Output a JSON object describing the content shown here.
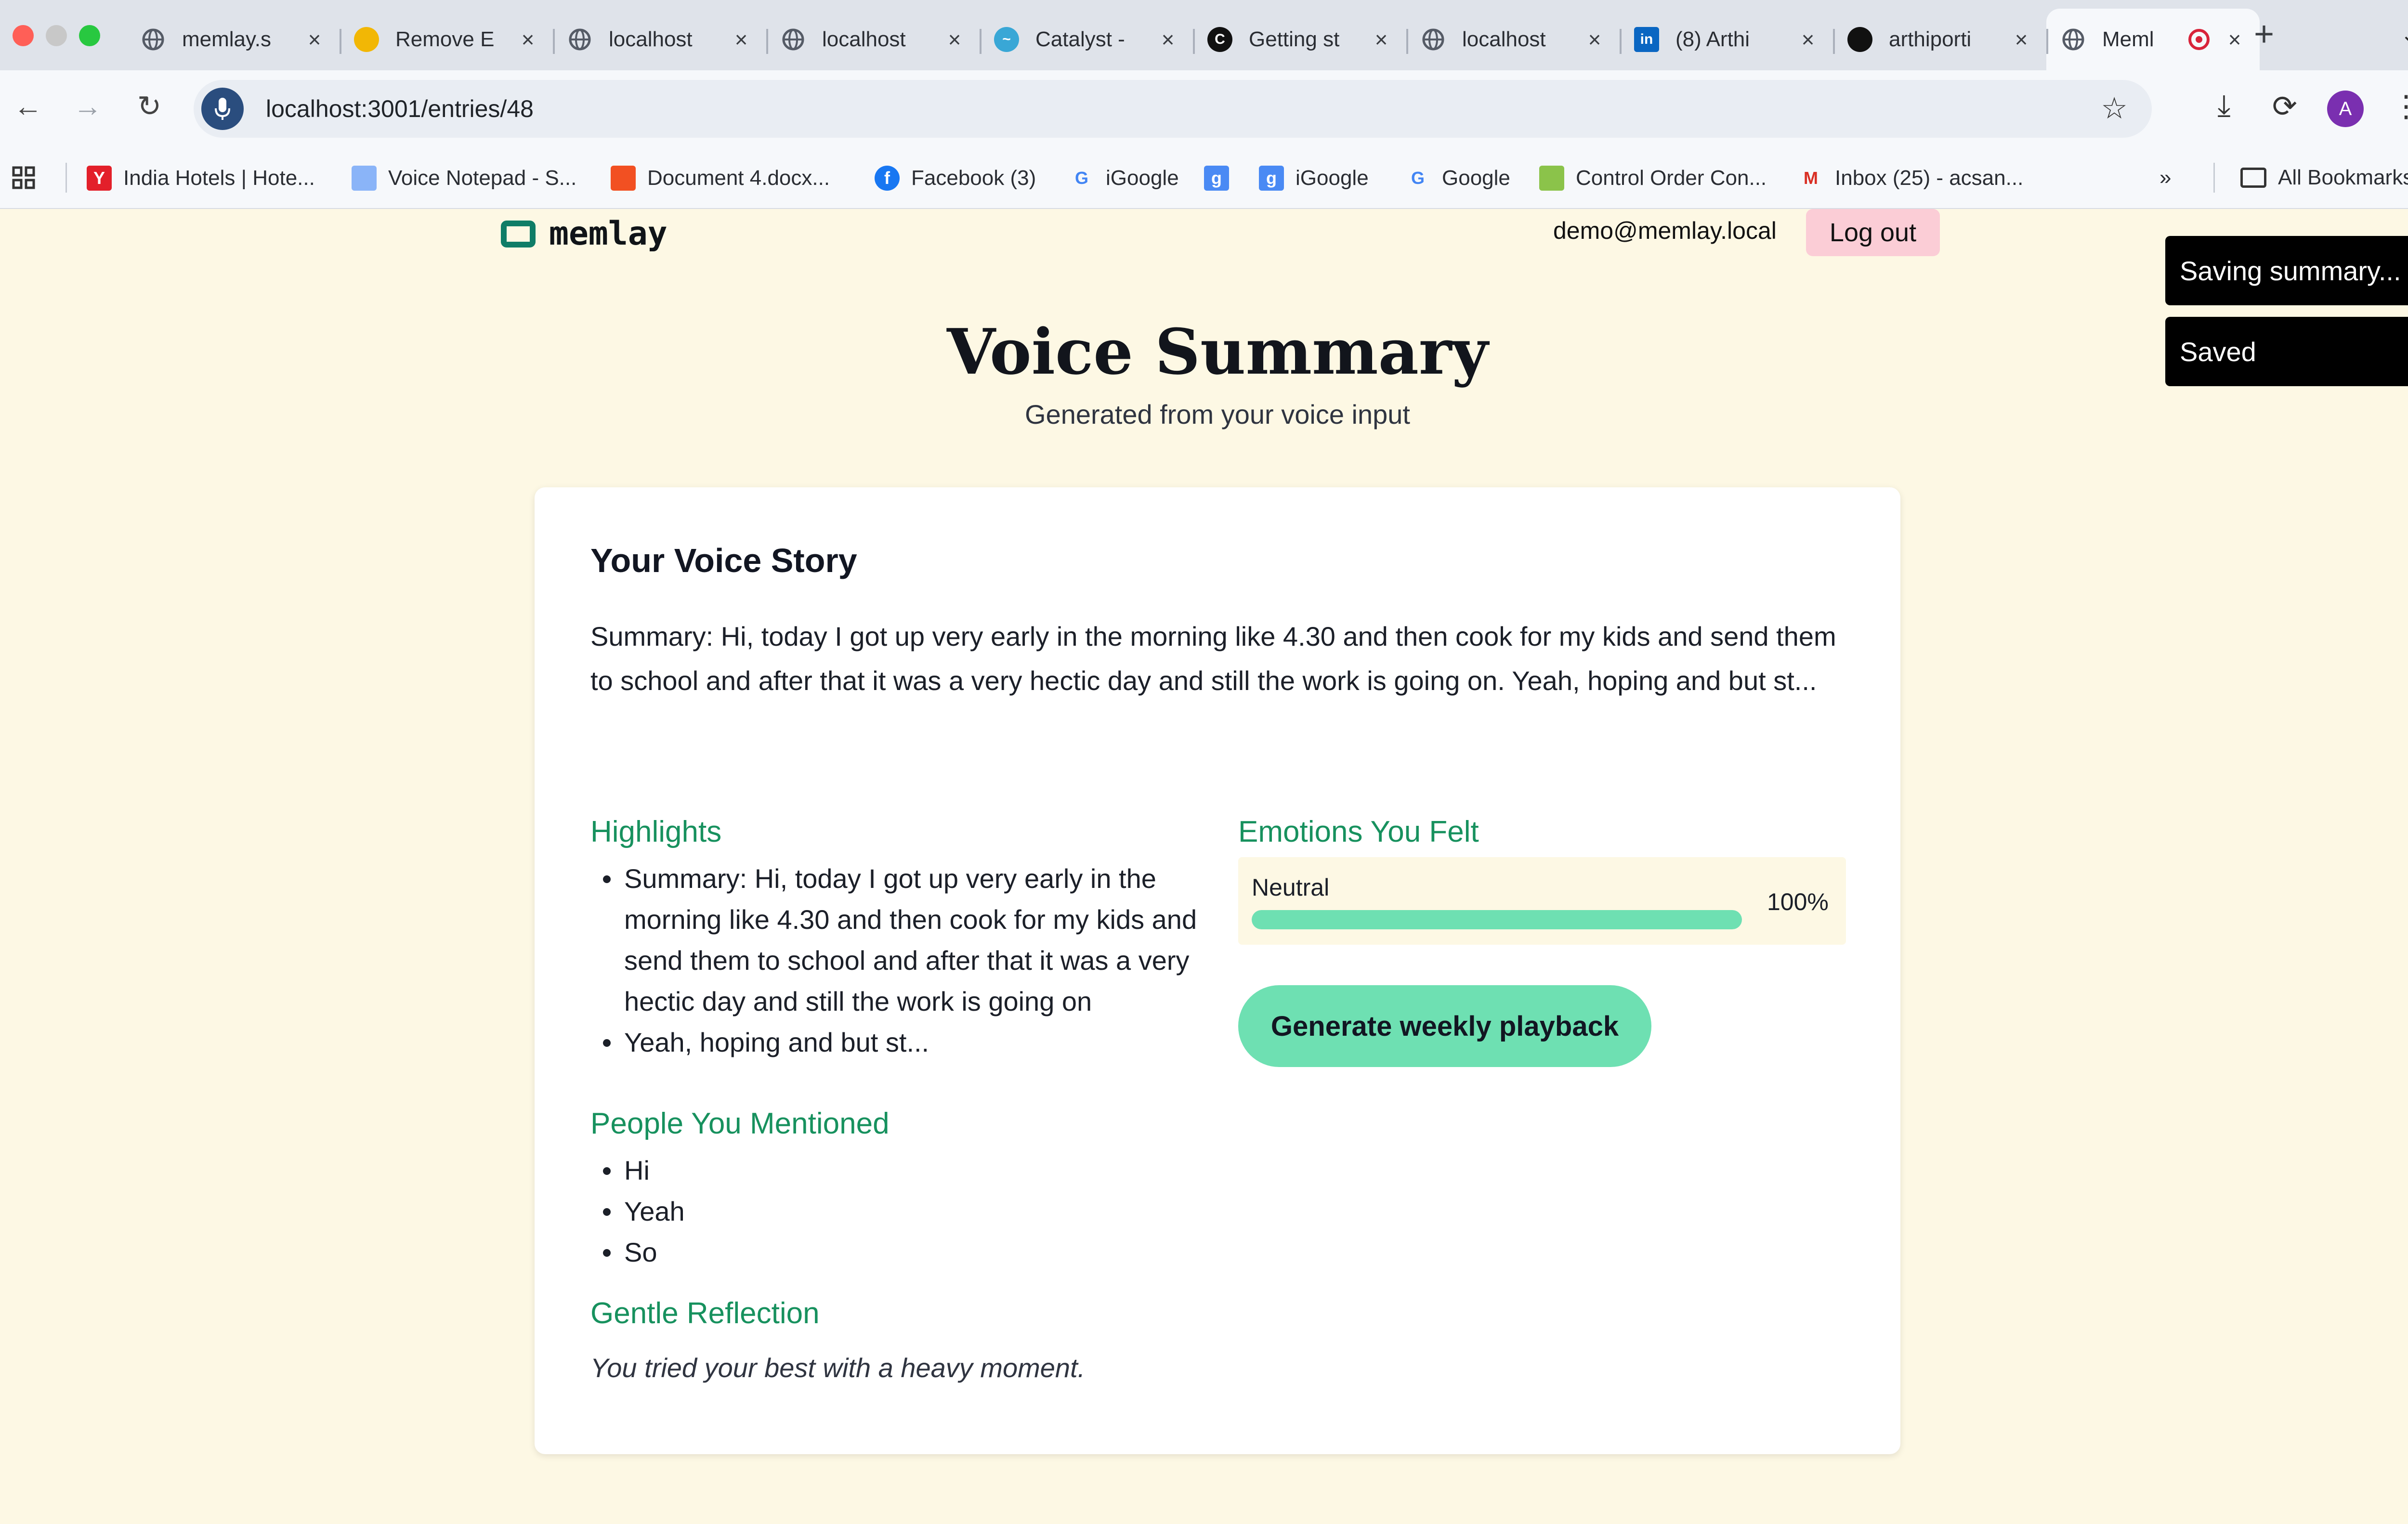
{
  "browser": {
    "tabs": [
      {
        "label": "memlay.s",
        "icon": "globe-icon",
        "color": "#555b66",
        "glyph": ""
      },
      {
        "label": "Remove E",
        "icon": "hat-icon",
        "color": "#f2b705",
        "glyph": ""
      },
      {
        "label": "localhost",
        "icon": "globe-icon",
        "color": "#555b66",
        "glyph": ""
      },
      {
        "label": "localhost",
        "icon": "globe-icon",
        "color": "#555b66",
        "glyph": ""
      },
      {
        "label": "Catalyst -",
        "icon": "wave-icon",
        "color": "#39a7d6",
        "glyph": "~"
      },
      {
        "label": "Getting st",
        "icon": "loop-icon",
        "color": "#111111",
        "glyph": "C"
      },
      {
        "label": "localhost",
        "icon": "globe-icon",
        "color": "#555b66",
        "glyph": ""
      },
      {
        "label": "(8) Arthi",
        "icon": "linkedin-icon",
        "color": "#0a66c2",
        "glyph": "in"
      },
      {
        "label": "arthiporti",
        "icon": "github-icon",
        "color": "#111111",
        "glyph": ""
      },
      {
        "label": "Meml",
        "icon": "globe-icon",
        "color": "#555b66",
        "glyph": "",
        "active": true
      }
    ],
    "new_tab": "+",
    "tab_menu": "⌄",
    "url": "localhost:3001/entries/48",
    "bookmarks": [
      {
        "label": "India Hotels | Hote...",
        "icon": "yatra-icon",
        "color": "#e3202a",
        "glyph": "Y"
      },
      {
        "label": "Voice Notepad - S...",
        "icon": "mic-icon",
        "color": "#8ab4f8",
        "glyph": ""
      },
      {
        "label": "Document 4.docx...",
        "icon": "windows-icon",
        "color": "#f25022",
        "glyph": ""
      },
      {
        "label": "Facebook (3)",
        "icon": "facebook-icon",
        "color": "#1877f2",
        "glyph": "f"
      },
      {
        "label": "iGoogle",
        "icon": "google-icon",
        "color": "#ffffff",
        "glyph": "G"
      },
      {
        "label": "",
        "icon": "igoogle-icon",
        "color": "#4a8af4",
        "glyph": "g"
      },
      {
        "label": "iGoogle",
        "icon": "igoogle-icon",
        "color": "#4a8af4",
        "glyph": "g"
      },
      {
        "label": "Google",
        "icon": "google-icon",
        "color": "#ffffff",
        "glyph": "G"
      },
      {
        "label": "Control Order Con...",
        "icon": "leaf-icon",
        "color": "#8bc34a",
        "glyph": ""
      },
      {
        "label": "Inbox (25) - acsan...",
        "icon": "gmail-icon",
        "color": "#ffffff",
        "glyph": "M"
      }
    ],
    "more_bookmarks": "»",
    "all_bookmarks": "All Bookmarks",
    "profile_initial": "A"
  },
  "app": {
    "brand": "memlay",
    "user_email": "demo@memlay.local",
    "logout_label": "Log out",
    "toasts": [
      "Saving summary...",
      "Saved"
    ],
    "page_title": "Voice Summary",
    "page_subtitle": "Generated from your voice input",
    "card": {
      "title": "Your Voice Story",
      "summary": "Summary: Hi, today I got up very early in the morning like 4.30 and then cook for my kids and send them to school and after that it was a very hectic day and still the work is going on. Yeah, hoping and but st...",
      "highlights_heading": "Highlights",
      "highlights": [
        "Summary: Hi, today I got up very early in the morning like 4.30 and then cook for my kids and send them to school and after that it was a very hectic day and still the work is going on",
        "Yeah, hoping and but st..."
      ],
      "people_heading": "People You Mentioned",
      "people": [
        "Hi",
        "Yeah",
        "So"
      ],
      "reflection_heading": "Gentle Reflection",
      "reflection": "You tried your best with a heavy moment.",
      "emotions_heading": "Emotions You Felt",
      "emotion": {
        "label": "Neutral",
        "percent_label": "100%",
        "fraction": 1.0
      },
      "playback_label": "Generate weekly playback"
    }
  },
  "colors": {
    "accent_green": "#17915e",
    "bar_green": "#6ee0b2",
    "page_bg": "#fdf8e4",
    "logout_bg": "#fbcdd6"
  }
}
